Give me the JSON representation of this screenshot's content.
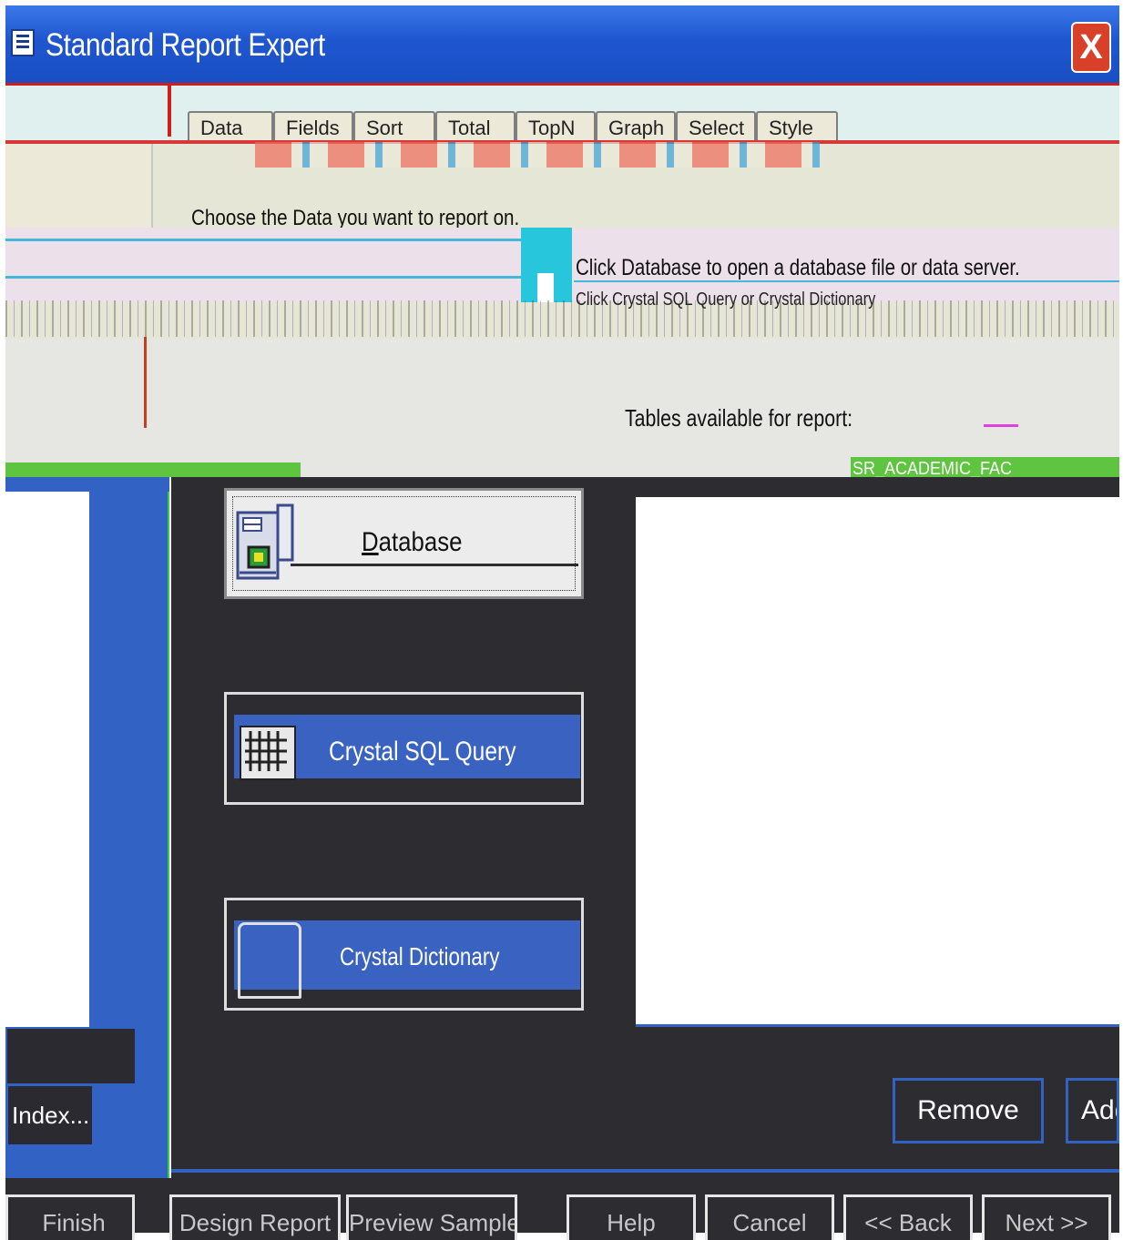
{
  "window": {
    "title": "Standard Report Expert",
    "close_label": "X"
  },
  "tabs": [
    {
      "label": "Data"
    },
    {
      "label": "Fields"
    },
    {
      "label": "Sort"
    },
    {
      "label": "Total"
    },
    {
      "label": "TopN"
    },
    {
      "label": "Graph"
    },
    {
      "label": "Select"
    },
    {
      "label": "Style"
    }
  ],
  "instructions": {
    "choose": "Choose the Data you want to report on.",
    "hint_database": "Click Database to open a database file or data server.",
    "hint_query": "Click Crystal SQL Query or Crystal Dictionary"
  },
  "tables": {
    "label": "Tables available for report:",
    "items": [
      "SR_ACADEMIC_FAC"
    ]
  },
  "data_buttons": {
    "database": "Database",
    "sql_query": "Crystal SQL Query",
    "dictionary": "Crystal Dictionary"
  },
  "actions": {
    "index": "Index...",
    "remove": "Remove",
    "add": "Add"
  },
  "footer": {
    "finish": "Finish",
    "design_report": "Design Report",
    "preview_sample": "Preview Sample",
    "help": "Help",
    "cancel": "Cancel",
    "back": "<< Back",
    "next": "Next >>"
  }
}
